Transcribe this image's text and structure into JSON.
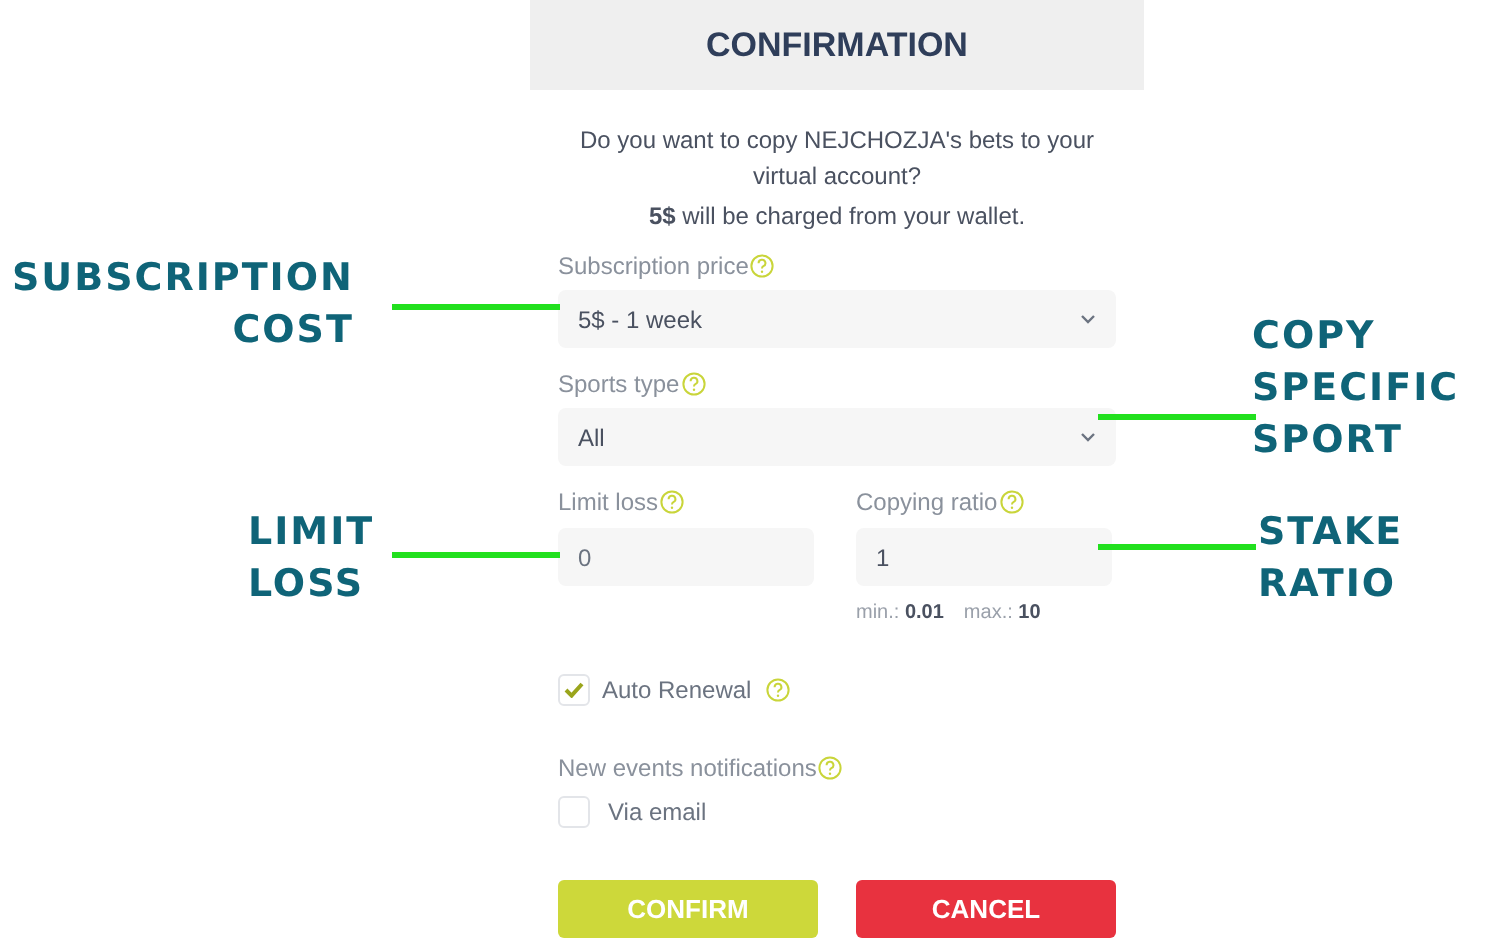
{
  "dialog": {
    "title": "CONFIRMATION",
    "question": "Do you want to copy NEJCHOZJA's bets to your virtual account?",
    "charge": "**5$** will be charged from your wallet.",
    "subscription": {
      "label": "Subscription price",
      "value": "5$ - 1 week"
    },
    "sports": {
      "label": "Sports type",
      "value": "All"
    },
    "limit_loss": {
      "label": "Limit loss",
      "value": "0"
    },
    "copying_ratio": {
      "label": "Copying ratio",
      "value": "1",
      "min_label": "min.:",
      "min": "0.01",
      "max_label": "max.:",
      "max": "10"
    },
    "auto_renewal": {
      "label": "Auto Renewal",
      "checked": true
    },
    "notifications": {
      "label": "New events notifications",
      "options": [
        {
          "label": "Via email",
          "checked": false
        }
      ]
    },
    "buttons": [
      {
        "label": "CONFIRM",
        "kind": "confirm"
      },
      {
        "label": "CANCEL",
        "kind": "cancel"
      }
    ]
  },
  "callouts": [
    {
      "lines": [
        "SUBSCRIPTION",
        "COST"
      ]
    },
    {
      "lines": [
        "LIMIT",
        "LOSS"
      ]
    },
    {
      "lines": [
        "COPY",
        "SPECIFIC",
        "SPORT"
      ]
    },
    {
      "lines": [
        "STAKE",
        "RATIO"
      ]
    }
  ]
}
